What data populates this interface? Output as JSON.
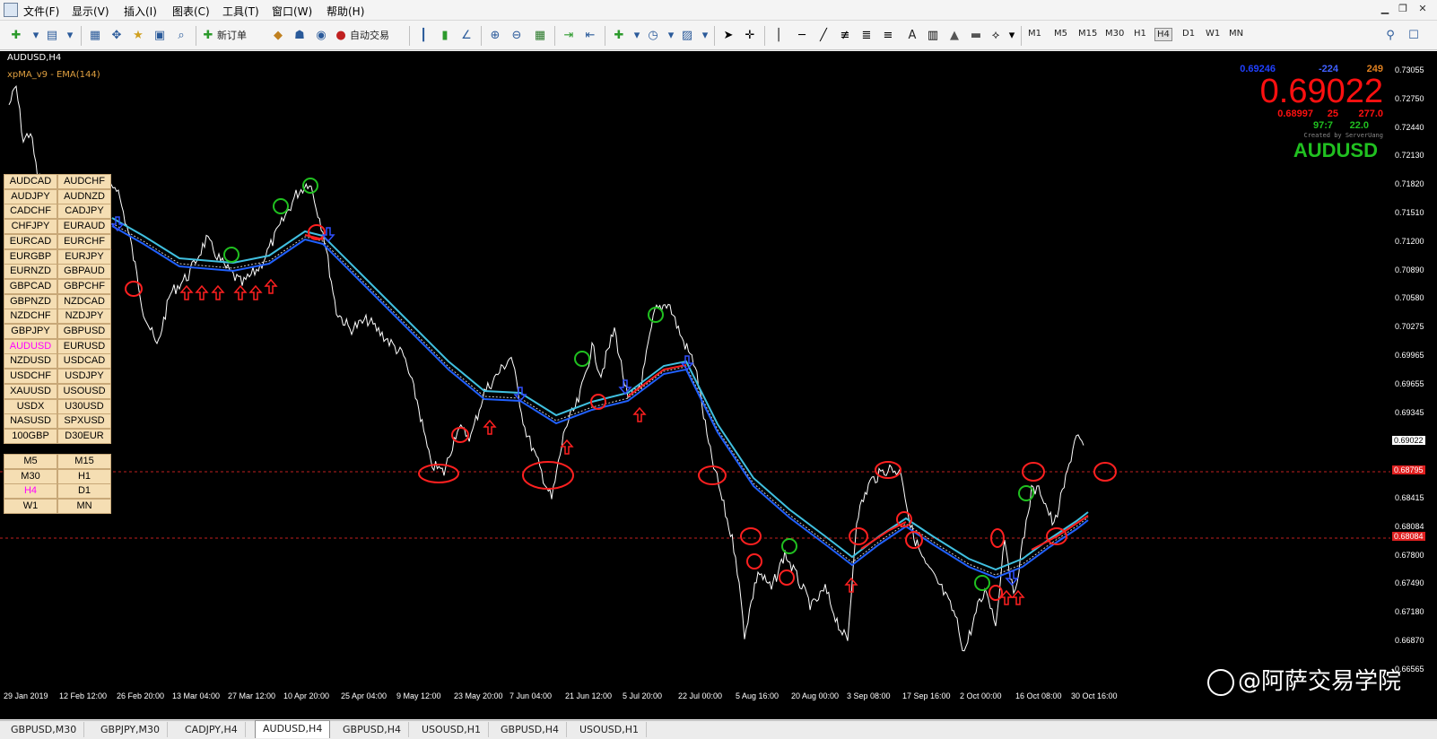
{
  "menubar": {
    "items": [
      "文件(F)",
      "显示(V)",
      "插入(I)",
      "图表(C)",
      "工具(T)",
      "窗口(W)",
      "帮助(H)"
    ]
  },
  "toolbar": {
    "new_order": "新订单",
    "auto_trading": "自动交易",
    "timeframes": [
      "M1",
      "M5",
      "M15",
      "M30",
      "H1",
      "H4",
      "D1",
      "W1",
      "MN"
    ],
    "active_timeframe": "H4",
    "drawing_letters": [
      "A"
    ]
  },
  "chart": {
    "symbol_title": "AUDUSD,H4",
    "indicator_name": "xpMA_v9 - EMA(144)",
    "symbols_left": [
      "AUDCAD",
      "AUDJPY",
      "CADCHF",
      "CHFJPY",
      "EURCAD",
      "EURGBP",
      "EURNZD",
      "GBPCAD",
      "GBPNZD",
      "NZDCHF",
      "GBPJPY",
      "AUDUSD",
      "NZDUSD",
      "USDCHF",
      "XAUUSD",
      "USDX",
      "NASUSD",
      "100GBP"
    ],
    "symbols_right": [
      "AUDCHF",
      "AUDNZD",
      "CADJPY",
      "EURAUD",
      "EURCHF",
      "EURJPY",
      "GBPAUD",
      "GBPCHF",
      "NZDCAD",
      "NZDJPY",
      "GBPUSD",
      "EURUSD",
      "USDCAD",
      "USDJPY",
      "USOUSD",
      "U30USD",
      "SPXUSD",
      "D30EUR"
    ],
    "highlighted_symbol": "AUDUSD",
    "tf_grid": [
      "M5",
      "M15",
      "M30",
      "H1",
      "H4",
      "D1",
      "W1",
      "MN"
    ],
    "highlighted_tf": "H4",
    "price_panel": {
      "small_price": "0.69246",
      "change": "-224",
      "spread_top": "249",
      "big_price": "0.69022",
      "low_price": "0.68997",
      "pips": "25",
      "points": "277.0",
      "ratio": "97:7",
      "value": "22.0",
      "credit": "Created by ServerUang",
      "symbol": "AUDUSD"
    },
    "y_axis_labels": [
      "0.73055",
      "0.72750",
      "0.72440",
      "0.72130",
      "0.71820",
      "0.71510",
      "0.71200",
      "0.70890",
      "0.70580",
      "0.70275",
      "0.69965",
      "0.69655",
      "0.69345",
      "0.69022",
      "0.68725",
      "0.68415",
      "0.68084",
      "0.67800",
      "0.67490",
      "0.67180",
      "0.66870",
      "0.66565"
    ],
    "y_price_marker": "0.69022",
    "y_red_marker_1": "0.68795",
    "y_red_marker_2": "0.68084",
    "x_axis_labels": [
      "29 Jan 2019",
      "12 Feb 12:00",
      "26 Feb 20:00",
      "13 Mar 04:00",
      "27 Mar 12:00",
      "10 Apr 20:00",
      "25 Apr 04:00",
      "9 May 12:00",
      "23 May 20:00",
      "7 Jun 04:00",
      "21 Jun 12:00",
      "5 Jul 20:00",
      "22 Jul 00:00",
      "5 Aug 16:00",
      "20 Aug 00:00",
      "3 Sep 08:00",
      "17 Sep 16:00",
      "2 Oct 00:00",
      "16 Oct 08:00",
      "30 Oct 16:00"
    ],
    "watermark": "@阿萨交易学院",
    "colors": {
      "price": "#ffffff",
      "ema_upper": "#40c0e0",
      "ema_lower": "#2060ff",
      "ema_red": "#ff2020",
      "happy": "#20c020",
      "sad": "#e02020"
    }
  },
  "tabs": [
    "GBPUSD,M30",
    "GBPJPY,M30",
    "CADJPY,H4",
    "AUDUSD,H4",
    "GBPUSD,H4",
    "USOUSD,H1",
    "GBPUSD,H4",
    "USOUSD,H1"
  ],
  "active_tab": "AUDUSD,H4"
}
